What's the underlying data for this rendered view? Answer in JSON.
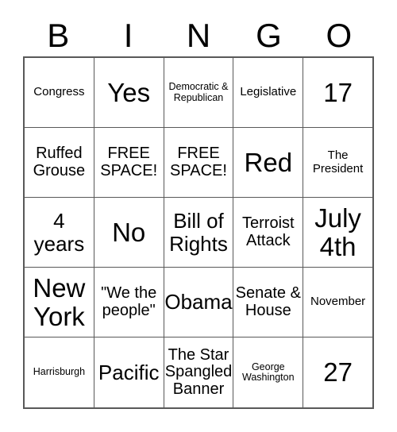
{
  "card": {
    "type": "bingo-card",
    "header": {
      "letters": [
        "B",
        "I",
        "N",
        "G",
        "O"
      ]
    },
    "grid": {
      "columns": 5,
      "rows": 5,
      "border_color": "#595959",
      "background_color": "#ffffff",
      "text_color": "#000000",
      "cells": [
        [
          {
            "text": "Congress",
            "size": "s"
          },
          {
            "text": "Yes",
            "size": "xl"
          },
          {
            "text": "Democratic & Republican",
            "size": "xs"
          },
          {
            "text": "Legislative",
            "size": "s"
          },
          {
            "text": "17",
            "size": "xl"
          }
        ],
        [
          {
            "text": "Ruffed Grouse",
            "size": "m"
          },
          {
            "text": "FREE SPACE!",
            "size": "m"
          },
          {
            "text": "FREE SPACE!",
            "size": "m"
          },
          {
            "text": "Red",
            "size": "xl"
          },
          {
            "text": "The President",
            "size": "s"
          }
        ],
        [
          {
            "text": "4 years",
            "size": "l"
          },
          {
            "text": "No",
            "size": "xl"
          },
          {
            "text": "Bill of Rights",
            "size": "l"
          },
          {
            "text": "Terroist Attack",
            "size": "m"
          },
          {
            "text": "July 4th",
            "size": "xl"
          }
        ],
        [
          {
            "text": "New York",
            "size": "xl"
          },
          {
            "text": "\"We the people\"",
            "size": "m"
          },
          {
            "text": "Obama",
            "size": "l"
          },
          {
            "text": "Senate & House",
            "size": "m"
          },
          {
            "text": "November",
            "size": "s"
          }
        ],
        [
          {
            "text": "Harrisburgh",
            "size": "xs"
          },
          {
            "text": "Pacific",
            "size": "l"
          },
          {
            "text": "The Star Spangled Banner",
            "size": "m"
          },
          {
            "text": "George Washington",
            "size": "xs"
          },
          {
            "text": "27",
            "size": "xl"
          }
        ]
      ]
    }
  }
}
